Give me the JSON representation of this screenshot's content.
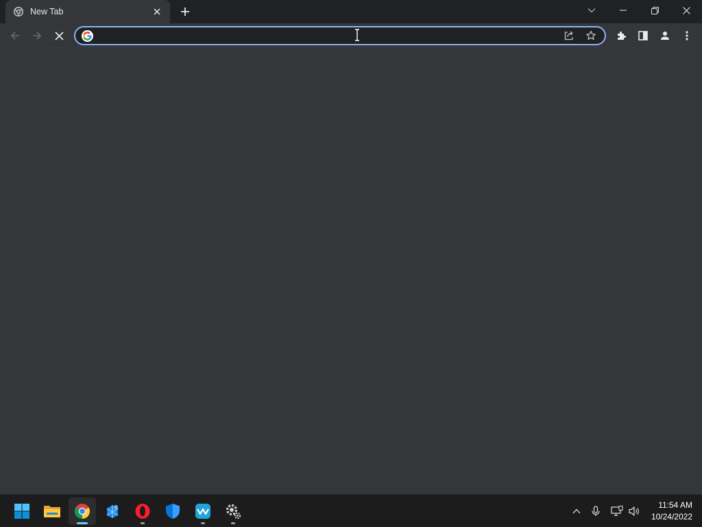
{
  "browser": {
    "tab": {
      "title": "New Tab",
      "favicon": "chrome-favicon-icon",
      "close_icon": "close-icon"
    },
    "new_tab_icon": "plus-icon",
    "window_controls": [
      "chevron-down-icon",
      "minimize-icon",
      "restore-icon",
      "close-icon"
    ],
    "toolbar": {
      "back_icon": "arrow-left-icon",
      "forward_icon": "arrow-right-icon",
      "stop_icon": "close-icon",
      "omnibox": {
        "value": "",
        "placeholder": "",
        "search_engine_icon": "google-icon"
      },
      "share_icon": "share-icon",
      "bookmark_icon": "star-icon",
      "extensions_icon": "puzzle-icon",
      "side_panel_icon": "side-panel-icon",
      "profile_icon": "person-icon",
      "menu_icon": "kebab-menu-icon"
    },
    "colors": {
      "frame": "#202124",
      "toolbar": "#35363a",
      "accent": "#8ab4f8"
    }
  },
  "taskbar": {
    "apps": [
      {
        "name": "windows-start-icon",
        "running": false
      },
      {
        "name": "file-explorer-icon",
        "running": false
      },
      {
        "name": "chrome-icon",
        "running": true,
        "focused": true
      },
      {
        "name": "azure-data-studio-icon",
        "running": false
      },
      {
        "name": "opera-icon",
        "running": true
      },
      {
        "name": "windows-security-icon",
        "running": false
      },
      {
        "name": "wave-app-icon",
        "running": true
      },
      {
        "name": "settings-gear-icon",
        "running": true
      }
    ],
    "tray": [
      "chevron-up-icon",
      "microphone-icon",
      "network-icon",
      "volume-icon"
    ],
    "clock": {
      "time": "11:54 AM",
      "date": "10/24/2022"
    }
  }
}
